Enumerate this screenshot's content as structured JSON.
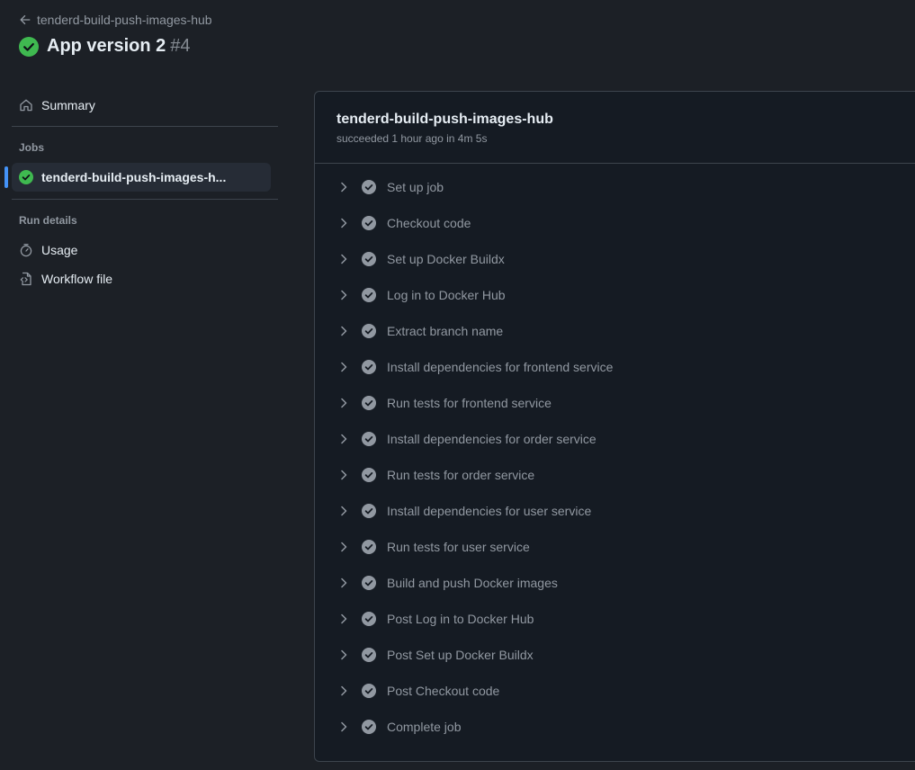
{
  "header": {
    "back_label": "tenderd-build-push-images-hub",
    "run_name": "App version 2",
    "run_number": "#4"
  },
  "sidebar": {
    "summary_label": "Summary",
    "jobs_heading": "Jobs",
    "job_label": "tenderd-build-push-images-h...",
    "run_details_heading": "Run details",
    "usage_label": "Usage",
    "workflow_file_label": "Workflow file"
  },
  "job": {
    "title": "tenderd-build-push-images-hub",
    "subtitle": "succeeded 1 hour ago in 4m 5s",
    "steps": [
      "Set up job",
      "Checkout code",
      "Set up Docker Buildx",
      "Log in to Docker Hub",
      "Extract branch name",
      "Install dependencies for frontend service",
      "Run tests for frontend service",
      "Install dependencies for order service",
      "Run tests for order service",
      "Install dependencies for user service",
      "Run tests for user service",
      "Build and push Docker images",
      "Post Log in to Docker Hub",
      "Post Set up Docker Buildx",
      "Post Checkout code",
      "Complete job"
    ]
  },
  "colors": {
    "success": "#3fb950",
    "step_check": "#9198a1",
    "accent": "#4493f8"
  }
}
